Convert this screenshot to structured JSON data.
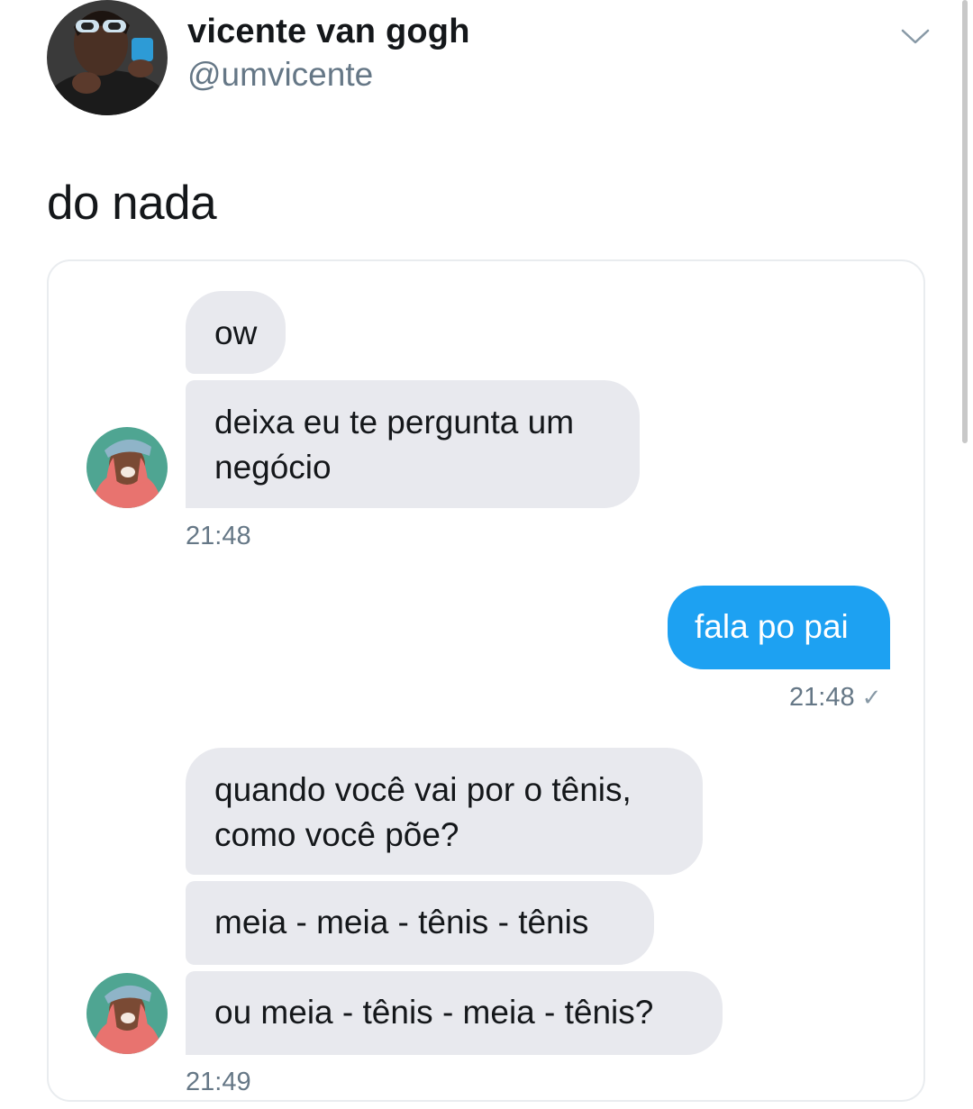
{
  "tweet": {
    "display_name": "vicente van gogh",
    "handle": "@umvicente",
    "text": "do nada"
  },
  "dm": {
    "messages": [
      {
        "id": "m1",
        "direction": "in",
        "text": "ow"
      },
      {
        "id": "m2",
        "direction": "in",
        "text": "deixa eu te pergunta um negócio"
      },
      {
        "id": "m3",
        "direction": "out",
        "text": "fala po pai"
      },
      {
        "id": "m4",
        "direction": "in",
        "text": "quando você vai por o tênis, como você põe?"
      },
      {
        "id": "m5",
        "direction": "in",
        "text": "meia - meia - tênis - tênis"
      },
      {
        "id": "m6",
        "direction": "in",
        "text": "ou meia - tênis - meia - tênis?"
      }
    ],
    "timestamps": {
      "t1": "21:48",
      "t2": "21:48",
      "t3": "21:49"
    },
    "read_check": "✓"
  },
  "colors": {
    "accent": "#1da1f2",
    "incoming_bubble": "#e8e9ee",
    "muted_text": "#657786"
  },
  "icons": [
    "chevron-down-icon",
    "profile-avatar",
    "sender-avatar",
    "read-check-icon"
  ]
}
